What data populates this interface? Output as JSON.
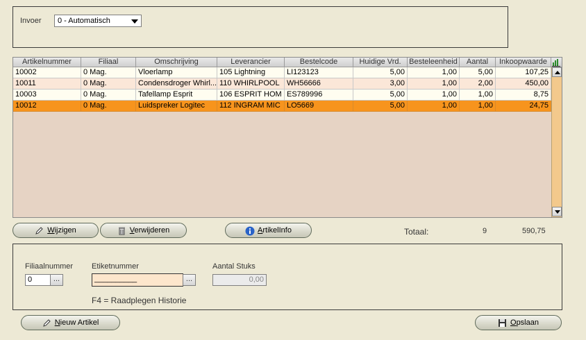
{
  "invoer": {
    "label": "Invoer",
    "value": "0 - Automatisch"
  },
  "grid": {
    "columns": [
      "Artikelnummer",
      "Filiaal",
      "Omschrijving",
      "Leverancier",
      "Bestelcode",
      "Huidige Vrd.",
      "Besteleenheid",
      "Aantal",
      "Inkoopwaarde"
    ],
    "rows": [
      [
        "10002",
        "0 Mag.",
        "Vloerlamp",
        "105 Lightning",
        "LI123123",
        "5,00",
        "1,00",
        "5,00",
        "107,25"
      ],
      [
        "10011",
        "0 Mag.",
        "Condensdroger Whirl...",
        "110 WHIRLPOOL",
        "WH56666",
        "3,00",
        "1,00",
        "2,00",
        "450,00"
      ],
      [
        "10003",
        "0 Mag.",
        "Tafellamp Esprit",
        "106 ESPRIT HOM",
        "ES789996",
        "5,00",
        "1,00",
        "1,00",
        "8,75"
      ],
      [
        "10012",
        "0 Mag.",
        "Luidspreker Logitec",
        "112 INGRAM MIC",
        "LO5669",
        "5,00",
        "1,00",
        "1,00",
        "24,75"
      ]
    ],
    "row_colors": [
      "#fffdf0",
      "#fbe7d8",
      "#fffdf0",
      "#f7941d"
    ],
    "selected_row": 3
  },
  "buttons": {
    "wijzigen": {
      "accel": "W",
      "rest": "ijzigen"
    },
    "verwijderen": {
      "accel": "V",
      "rest": "erwijderen"
    },
    "artikelinfo": {
      "accel": "A",
      "rest": "rtikelInfo"
    },
    "nieuw": {
      "accel": "N",
      "rest": "ieuw Artikel"
    },
    "opslaan": {
      "accel": "O",
      "rest": "pslaan"
    },
    "dots": "..."
  },
  "totaal": {
    "label": "Totaal:",
    "count": "9",
    "sum": "590,75"
  },
  "form": {
    "filiaal_label": "Filiaalnummer",
    "filiaal_value": "0",
    "etiket_label": "Etiketnummer",
    "etiket_value": "__________",
    "aantal_label": "Aantal Stuks",
    "aantal_value": "0,00",
    "hint": "F4 = Raadplegen Historie"
  }
}
